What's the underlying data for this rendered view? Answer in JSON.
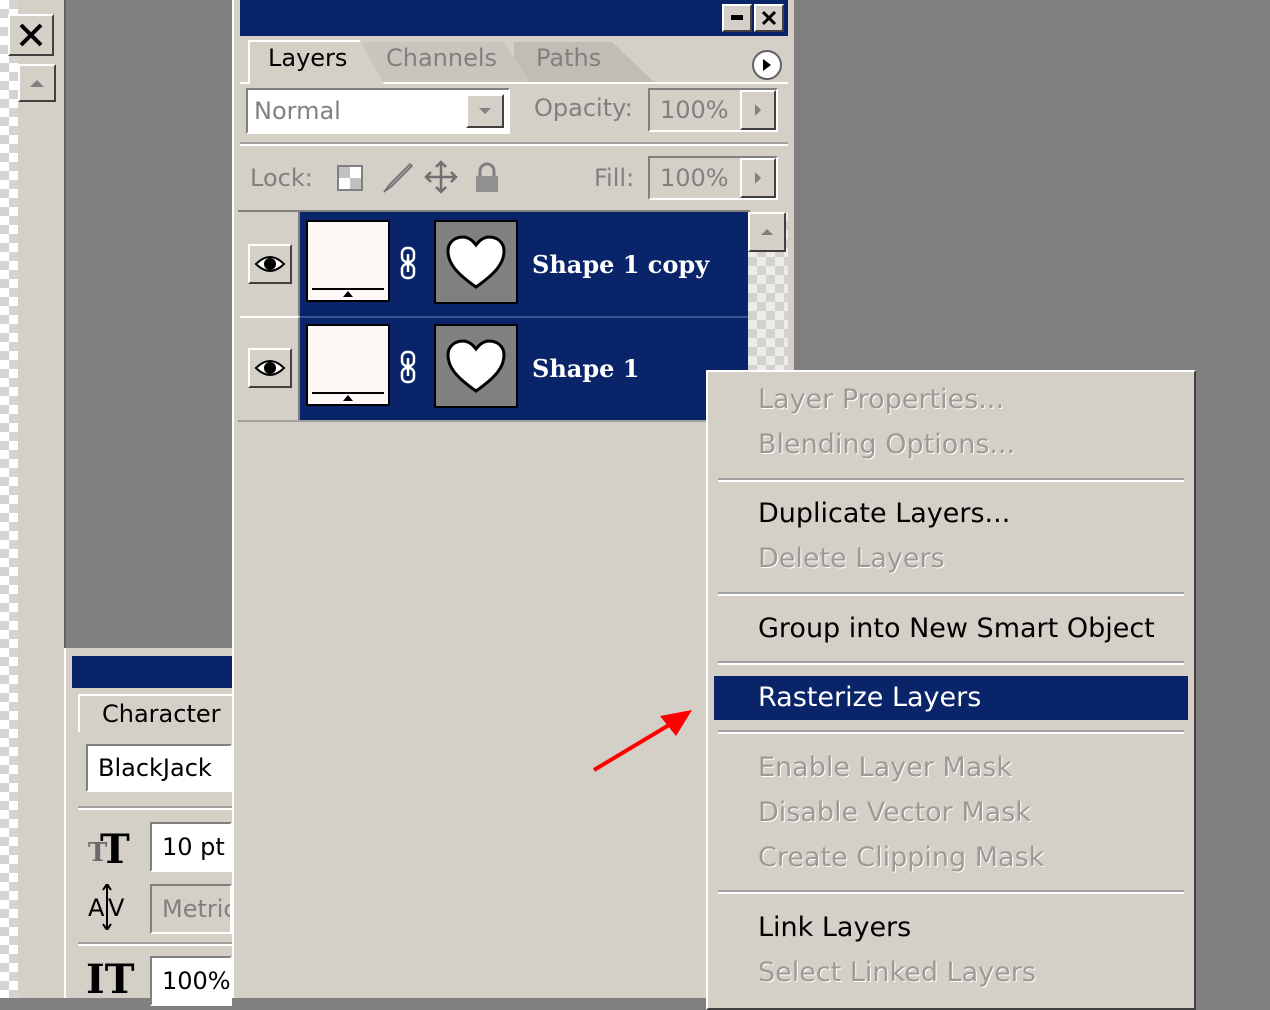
{
  "layers_panel": {
    "tabs": [
      "Layers",
      "Channels",
      "Paths"
    ],
    "blend_mode": "Normal",
    "opacity_label": "Opacity:",
    "opacity_value": "100%",
    "lock_label": "Lock:",
    "fill_label": "Fill:",
    "fill_value": "100%",
    "layers": [
      {
        "name": "Shape 1 copy",
        "visible": true
      },
      {
        "name": "Shape 1",
        "visible": true
      }
    ]
  },
  "character_panel": {
    "tab": "Character",
    "font_family": "BlackJack",
    "font_size": "10 pt",
    "tracking": "Metric",
    "vertical_scale": "100%"
  },
  "context_menu": {
    "items": [
      {
        "label": "Layer Properties...",
        "enabled": false
      },
      {
        "label": "Blending Options...",
        "enabled": false
      },
      {
        "label": "Duplicate Layers...",
        "enabled": true
      },
      {
        "label": "Delete Layers",
        "enabled": false
      },
      {
        "label": "Group into New Smart Object",
        "enabled": true
      },
      {
        "label": "Rasterize Layers",
        "enabled": true,
        "selected": true
      },
      {
        "label": "Enable Layer Mask",
        "enabled": false
      },
      {
        "label": "Disable Vector Mask",
        "enabled": false
      },
      {
        "label": "Create Clipping Mask",
        "enabled": false
      },
      {
        "label": "Link Layers",
        "enabled": true
      },
      {
        "label": "Select Linked Layers",
        "enabled": false
      }
    ]
  },
  "colors": {
    "panel": "#d4d0c8",
    "title_bar": "#0a246a",
    "selection": "#0a246a",
    "workspace": "#808080",
    "arrow": "#ff0000"
  },
  "icons": [
    "close-icon",
    "minimize-icon",
    "scroll-up-icon",
    "panel-menu-icon",
    "dropdown-arrow-icon",
    "lock-transparency-icon",
    "lock-paint-icon",
    "lock-move-icon",
    "lock-all-icon",
    "eye-icon",
    "link-icon",
    "heart-mask-icon",
    "font-size-icon",
    "tracking-icon",
    "vertical-scale-icon",
    "red-arrow-annotation"
  ]
}
